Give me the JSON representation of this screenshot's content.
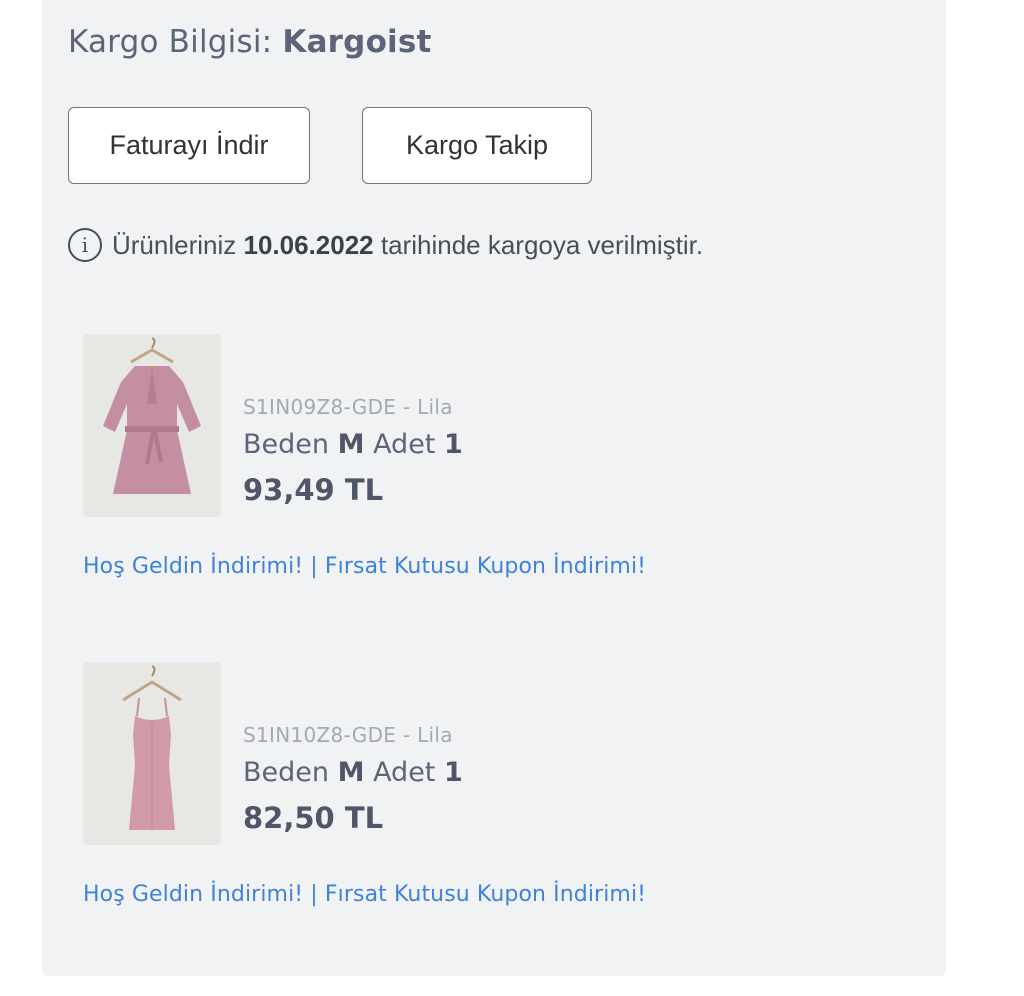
{
  "shipping": {
    "label": "Kargo Bilgisi:",
    "carrier": "Kargoist"
  },
  "buttons": {
    "invoice": "Faturayı İndir",
    "track": "Kargo Takip"
  },
  "notice": {
    "icon": "info-icon",
    "prefix": "Ürünleriniz",
    "date": "10.06.2022",
    "suffix": "tarihinde kargoya verilmiştir."
  },
  "products": [
    {
      "sku_color": "S1IN09Z8-GDE - Lila",
      "size_label": "Beden",
      "size": "M",
      "qty_label": "Adet",
      "qty": "1",
      "price": "93,49 TL",
      "promo": "Hoş Geldin İndirimi! | Fırsat Kutusu Kupon İndirimi!",
      "image_color": "#c58fa3"
    },
    {
      "sku_color": "S1IN10Z8-GDE - Lila",
      "size_label": "Beden",
      "size": "M",
      "qty_label": "Adet",
      "qty": "1",
      "price": "82,50 TL",
      "promo": "Hoş Geldin İndirimi! | Fırsat Kutusu Kupon İndirimi!",
      "image_color": "#d29aa8"
    }
  ],
  "colors": {
    "card_background": "#f1f2f4",
    "link": "#3f83d9",
    "text": "#5b6478"
  }
}
